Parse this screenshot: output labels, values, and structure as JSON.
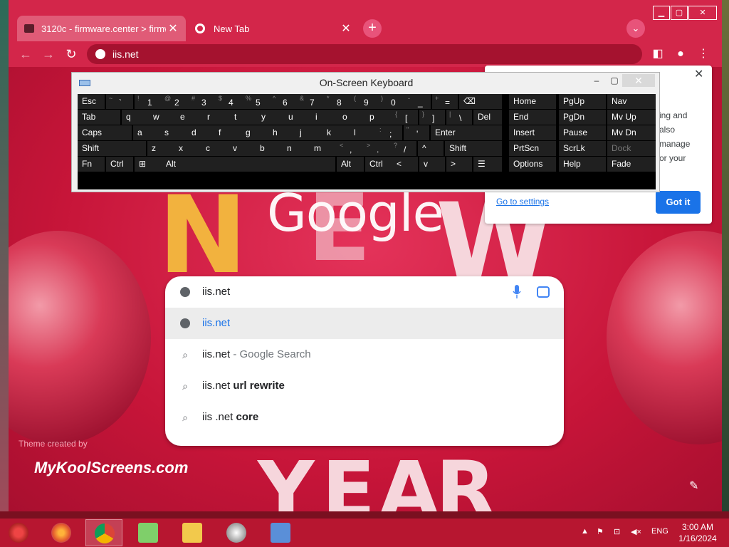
{
  "browser": {
    "tabs": [
      {
        "title": "3120c - firmware.center > firmw",
        "active": false
      },
      {
        "title": "New Tab",
        "active": true
      }
    ],
    "address": "iis.net",
    "window_controls": [
      "minimize",
      "restore",
      "close"
    ]
  },
  "ntp": {
    "logo": "Google",
    "watermark": "MyKoolScreens.com",
    "theme_credit": "Theme created by",
    "deco_text": [
      "N",
      "E",
      "W",
      "Y",
      "E",
      "A",
      "R"
    ]
  },
  "omnibox_dropdown": {
    "input": "iis.net",
    "suggestions": [
      {
        "icon": "globe-icon",
        "parts": [
          {
            "text": "iis.net",
            "style": "link"
          }
        ],
        "highlighted": true
      },
      {
        "icon": "search-icon",
        "parts": [
          {
            "text": "iis.net",
            "style": "normal"
          },
          {
            "text": " - Google Search",
            "style": "grey"
          }
        ],
        "highlighted": false
      },
      {
        "icon": "search-icon",
        "parts": [
          {
            "text": "iis.net ",
            "style": "normal"
          },
          {
            "text": "url rewrite",
            "style": "bold"
          }
        ],
        "highlighted": false
      },
      {
        "icon": "search-icon",
        "parts": [
          {
            "text": "iis .net ",
            "style": "normal"
          },
          {
            "text": "core",
            "style": "bold"
          }
        ],
        "highlighted": false
      }
    ]
  },
  "popup": {
    "fragments": [
      "ing and",
      "also",
      "manage",
      "or your"
    ],
    "link": "Go to settings",
    "button": "Got it"
  },
  "osk": {
    "title": "On-Screen Keyboard",
    "rows": [
      [
        [
          "Esc",
          ""
        ],
        [
          "~ `",
          ""
        ],
        [
          "! 1",
          ""
        ],
        [
          "@ 2",
          ""
        ],
        [
          "# 3",
          ""
        ],
        [
          "$ 4",
          ""
        ],
        [
          "% 5",
          ""
        ],
        [
          "^ 6",
          ""
        ],
        [
          "& 7",
          ""
        ],
        [
          "* 8",
          ""
        ],
        [
          "( 9",
          ""
        ],
        [
          ") 0",
          ""
        ],
        [
          "- _",
          ""
        ],
        [
          "+ =",
          ""
        ],
        [
          "⌫",
          ""
        ]
      ],
      [
        [
          "Tab",
          ""
        ],
        [
          "q",
          ""
        ],
        [
          "w",
          ""
        ],
        [
          "e",
          ""
        ],
        [
          "r",
          ""
        ],
        [
          "t",
          ""
        ],
        [
          "y",
          ""
        ],
        [
          "u",
          ""
        ],
        [
          "i",
          ""
        ],
        [
          "o",
          ""
        ],
        [
          "p",
          ""
        ],
        [
          "{ [",
          ""
        ],
        [
          "} ]",
          ""
        ],
        [
          "| \\",
          ""
        ],
        [
          "Del",
          ""
        ]
      ],
      [
        [
          "Caps",
          ""
        ],
        [
          "a",
          ""
        ],
        [
          "s",
          ""
        ],
        [
          "d",
          ""
        ],
        [
          "f",
          ""
        ],
        [
          "g",
          ""
        ],
        [
          "h",
          ""
        ],
        [
          "j",
          ""
        ],
        [
          "k",
          ""
        ],
        [
          "l",
          ""
        ],
        [
          ": ;",
          ""
        ],
        [
          "\" '",
          ""
        ],
        [
          "Enter",
          ""
        ]
      ],
      [
        [
          "Shift",
          ""
        ],
        [
          "z",
          ""
        ],
        [
          "x",
          ""
        ],
        [
          "c",
          ""
        ],
        [
          "v",
          ""
        ],
        [
          "b",
          ""
        ],
        [
          "n",
          ""
        ],
        [
          "m",
          ""
        ],
        [
          "< ,",
          ""
        ],
        [
          "> .",
          ""
        ],
        [
          "? /",
          ""
        ],
        [
          "^",
          ""
        ],
        [
          "Shift",
          ""
        ]
      ],
      [
        [
          "Fn",
          ""
        ],
        [
          "Ctrl",
          ""
        ],
        [
          "⊞",
          ""
        ],
        [
          "Alt",
          ""
        ],
        [
          "",
          ""
        ],
        [
          "Alt",
          ""
        ],
        [
          "Ctrl",
          ""
        ],
        [
          "<",
          ""
        ],
        [
          "v",
          ""
        ],
        [
          ">",
          ""
        ],
        [
          "☰",
          ""
        ]
      ]
    ],
    "nav_keys": [
      [
        "Home",
        "PgUp",
        "Nav"
      ],
      [
        "End",
        "PgDn",
        "Mv Up"
      ],
      [
        "Insert",
        "Pause",
        "Mv Dn"
      ],
      [
        "PrtScn",
        "ScrLk",
        "Dock"
      ],
      [
        "Options",
        "Help",
        "Fade"
      ]
    ]
  },
  "taskbar": {
    "apps": [
      "start-orb",
      "firefox",
      "chrome",
      "battery-app",
      "file-explorer",
      "flash",
      "remote-desktop"
    ],
    "tray_language": "ENG",
    "time": "3:00 AM",
    "date": "1/16/2024"
  }
}
